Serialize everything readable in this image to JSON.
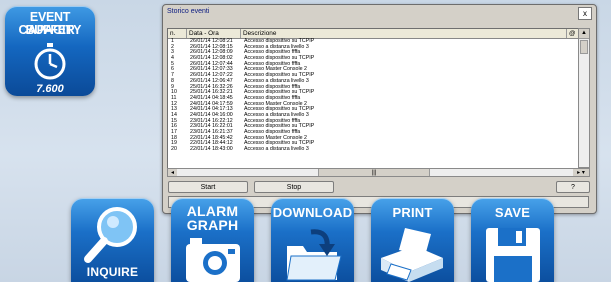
{
  "badge": {
    "line1": "EVENT BUFFER",
    "line2": "CAPACITY",
    "number": "7.600",
    "icon": "stopwatch-icon"
  },
  "window": {
    "title": "Storico eventi",
    "close": "x",
    "columns": [
      "n.",
      "Data - Ora",
      "Descrizione",
      "@"
    ],
    "rows": [
      [
        "1",
        "26/01/14 12:08:21",
        "Accesso dispositivo su TCPIP"
      ],
      [
        "2",
        "26/01/14 12:08:15",
        "Accesso a distanza livello 3"
      ],
      [
        "3",
        "26/01/14 12:08:09",
        "Accesso dispositivo ffffa"
      ],
      [
        "4",
        "26/01/14 12:08:02",
        "Accesso dispositivo su TCPIP"
      ],
      [
        "5",
        "26/01/14 12:07:44",
        "Accesso dispositivo ffffa"
      ],
      [
        "6",
        "26/01/14 12:07:33",
        "Accesso Master Console 2"
      ],
      [
        "7",
        "26/01/14 12:07:22",
        "Accesso dispositivo su TCPIP"
      ],
      [
        "8",
        "26/01/14 12:06:47",
        "Accesso a distanza livello 3"
      ],
      [
        "9",
        "25/01/14 16:32:26",
        "Accesso dispositivo ffffa"
      ],
      [
        "10",
        "25/01/14 16:32:21",
        "Accesso dispositivo su TCPIP"
      ],
      [
        "11",
        "24/01/14 04:18:45",
        "Accesso dispositivo ffffa"
      ],
      [
        "12",
        "24/01/14 04:17:59",
        "Accesso Master Console 2"
      ],
      [
        "13",
        "24/01/14 04:17:13",
        "Accesso dispositivo su TCPIP"
      ],
      [
        "14",
        "24/01/14 04:16:00",
        "Accesso a distanza livello 3"
      ],
      [
        "15",
        "23/01/14 16:22:12",
        "Accesso dispositivo ffffa"
      ],
      [
        "16",
        "23/01/14 16:22:01",
        "Accesso dispositivo su TCPIP"
      ],
      [
        "17",
        "23/01/14 16:21:37",
        "Accesso dispositivo ffffa"
      ],
      [
        "18",
        "22/01/14 18:45:42",
        "Accesso Master Console 2"
      ],
      [
        "19",
        "22/01/14 18:44:12",
        "Accesso dispositivo su TCPIP"
      ],
      [
        "20",
        "22/01/14 18:43:00",
        "Accesso a distanza livello 3"
      ]
    ],
    "scroll_thumb": "|||",
    "buttons": {
      "start": "Start",
      "stop": "Stop",
      "help": "?"
    }
  },
  "actions": [
    {
      "label": "INQUIRE",
      "icon": "magnifier-icon"
    },
    {
      "label": "ALARM GRAPH",
      "icon": "camera-icon"
    },
    {
      "label": "DOWNLOAD",
      "icon": "folder-download-icon"
    },
    {
      "label": "PRINT",
      "icon": "printer-icon"
    },
    {
      "label": "SAVE",
      "icon": "floppy-disk-icon"
    }
  ],
  "colors": {
    "tile_blue": "#1b70c8",
    "background": "#d7e2ee"
  }
}
